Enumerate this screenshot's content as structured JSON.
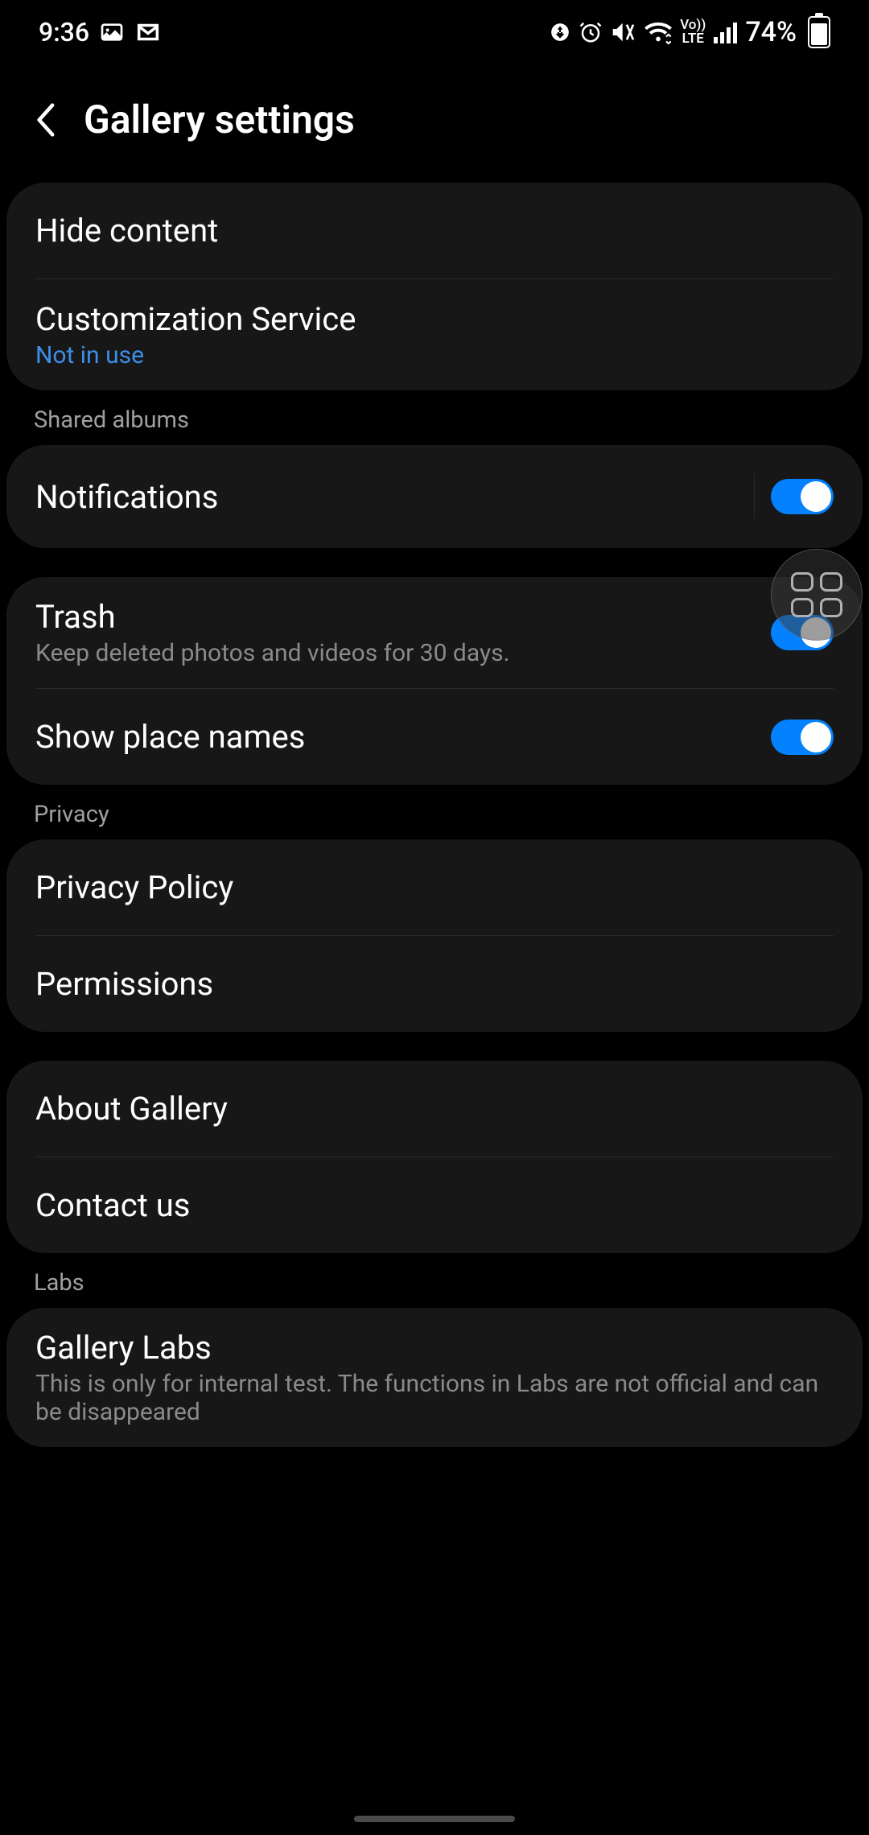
{
  "status": {
    "time": "9:36",
    "battery": "74%",
    "network_label": "LTE",
    "volte": "Vo))"
  },
  "header": {
    "title": "Gallery settings"
  },
  "settings": {
    "hide_content": "Hide content",
    "customization_service": {
      "title": "Customization Service",
      "status": "Not in use"
    },
    "shared_albums_header": "Shared albums",
    "notifications": "Notifications",
    "trash": {
      "title": "Trash",
      "subtitle": "Keep deleted photos and videos for 30 days."
    },
    "show_place_names": "Show place names",
    "privacy_header": "Privacy",
    "privacy_policy": "Privacy Policy",
    "permissions": "Permissions",
    "about_gallery": "About Gallery",
    "contact_us": "Contact us",
    "labs_header": "Labs",
    "gallery_labs": {
      "title": "Gallery Labs",
      "subtitle": "This is only for internal test. The functions in Labs are not official and can be disappeared"
    }
  },
  "toggles": {
    "notifications": true,
    "trash": true,
    "show_place_names": true
  }
}
